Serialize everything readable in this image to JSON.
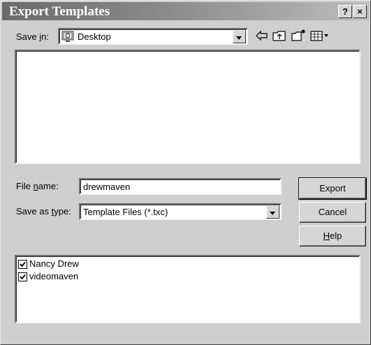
{
  "window": {
    "title": "Export Templates",
    "help_button": "?",
    "close_button": "×"
  },
  "toolbar": {
    "save_in_label": "Save in:",
    "location": "Desktop",
    "icons": [
      "back-arrow-icon",
      "up-folder-icon",
      "new-folder-icon",
      "view-menu-icon"
    ]
  },
  "file_list": {
    "items": []
  },
  "form": {
    "file_name_label": "File name:",
    "file_name_value": "drewmaven",
    "save_as_type_label": "Save as type:",
    "save_as_type_value": "Template Files (*.txc)"
  },
  "buttons": {
    "export": "Export",
    "cancel": "Cancel",
    "help": "Help"
  },
  "templates": [
    {
      "label": "Nancy Drew",
      "checked": true
    },
    {
      "label": "videomaven",
      "checked": true
    }
  ]
}
